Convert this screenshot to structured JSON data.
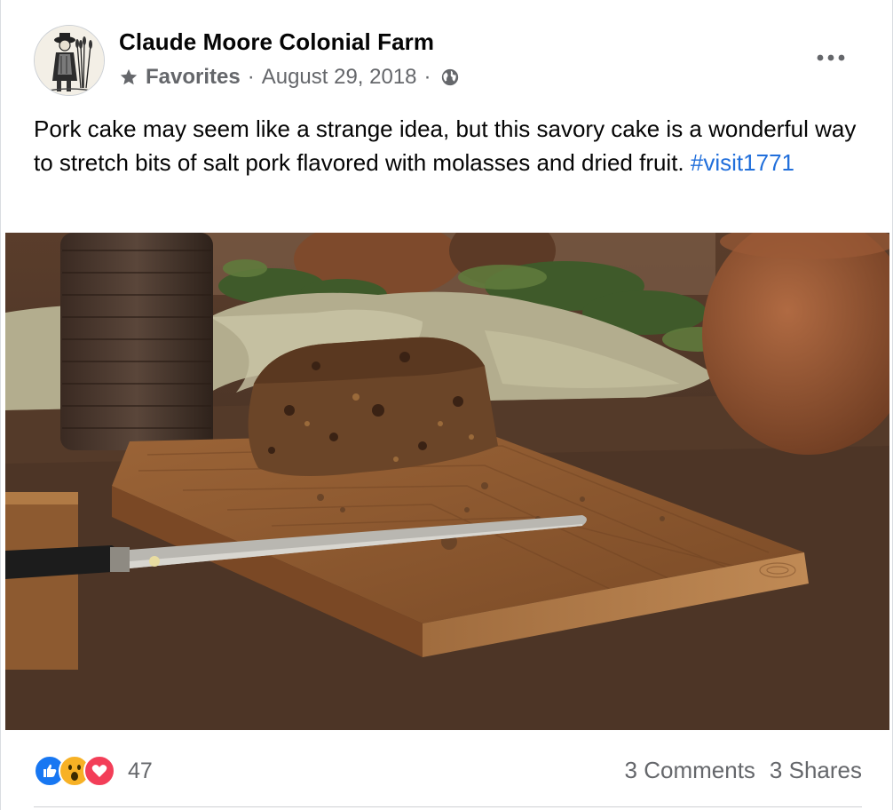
{
  "post": {
    "page_name": "Claude Moore Colonial Farm",
    "audience_label": "Favorites",
    "separator": "·",
    "date": "August 29, 2018",
    "text": "Pork cake may seem like a strange idea, but this savory cake is a wonderful way to stretch bits of salt pork flavored with molasses and dried fruit.",
    "hashtag": "#visit1771",
    "icons": {
      "avatar": "colonial-farmer-engraving",
      "audience": "star-icon",
      "privacy": "globe-icon",
      "menu": "more-options-icon"
    },
    "photo_subject": "pork-cake-on-cutting-board"
  },
  "reactions": {
    "types": [
      "like",
      "wow",
      "love"
    ],
    "count": "47"
  },
  "stats": {
    "comments": "3 Comments",
    "shares": "3 Shares"
  },
  "colors": {
    "link": "#216fdb",
    "secondary_text": "#65676b",
    "like": "#1877f2",
    "love": "#f33e58",
    "wow": "#f7b125"
  }
}
